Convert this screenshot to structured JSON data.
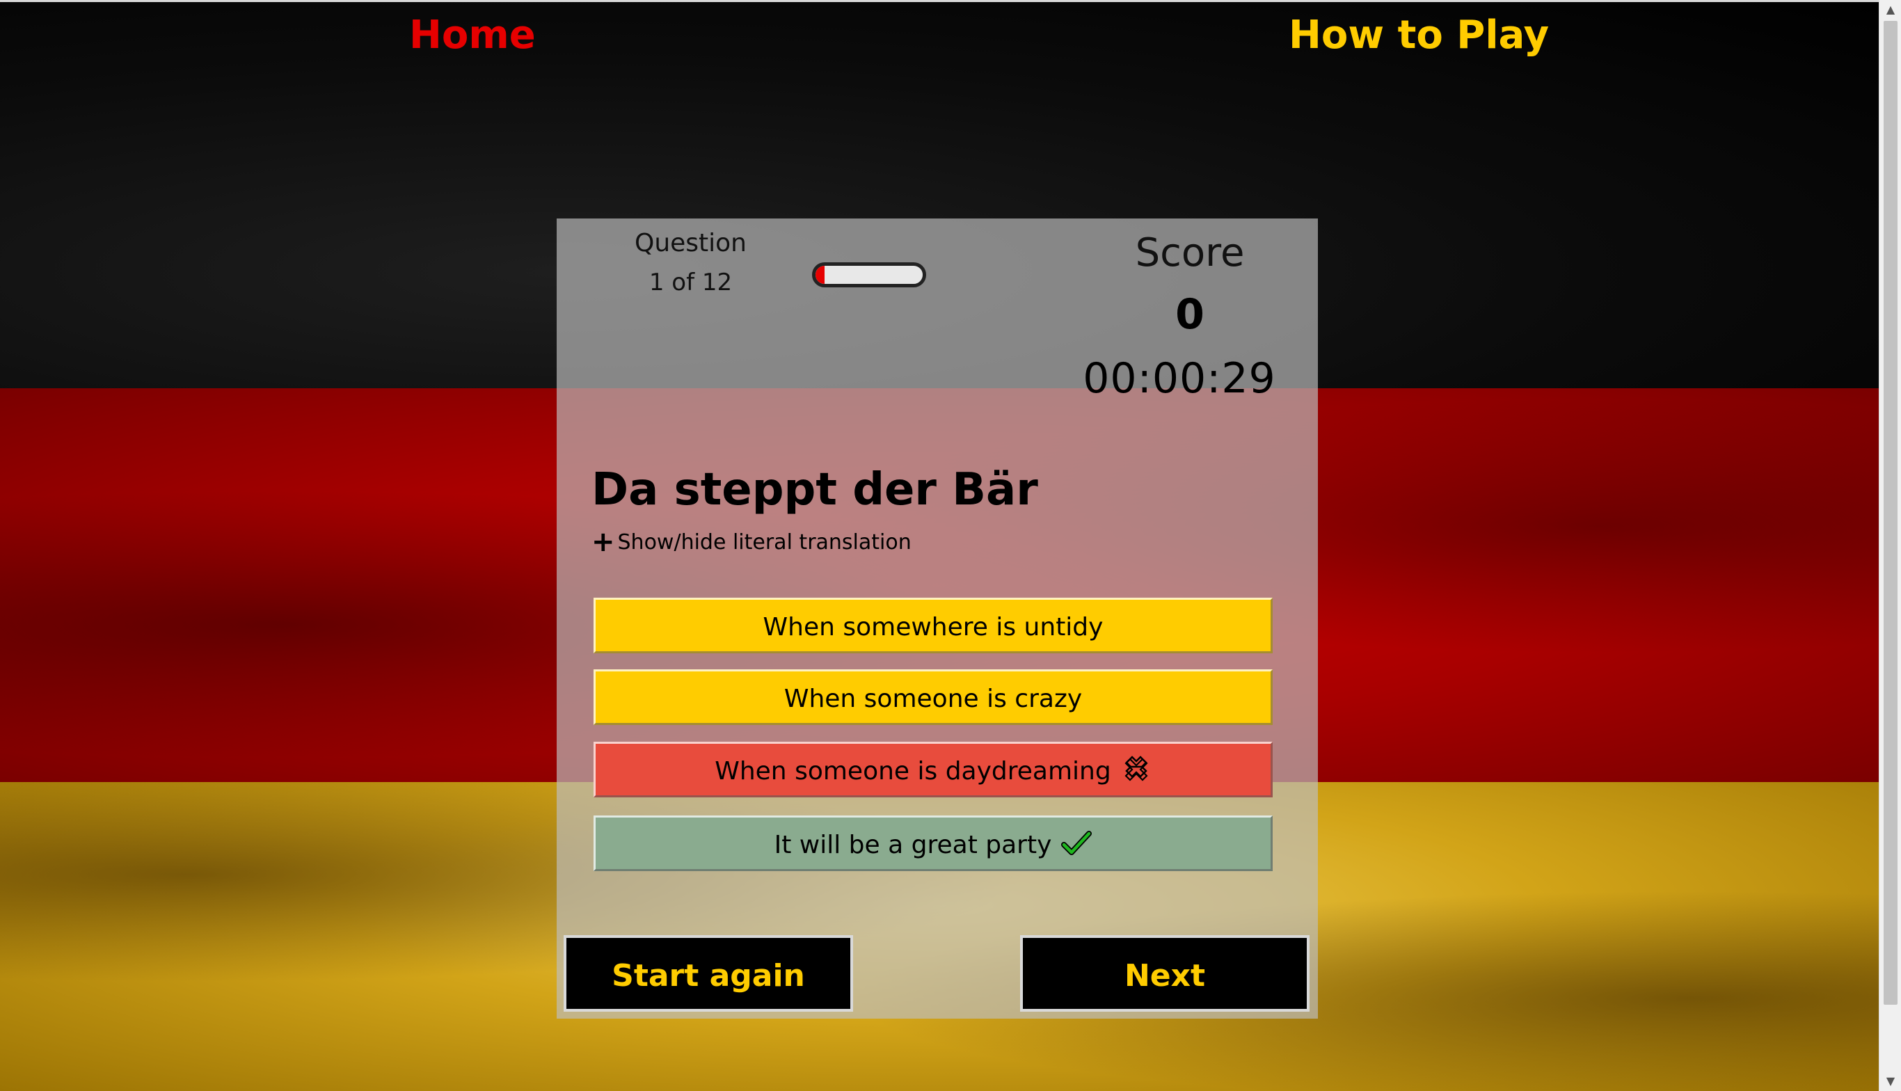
{
  "nav": {
    "home_label": "Home",
    "how_to_play_label": "How to Play"
  },
  "quiz": {
    "question_label": "Question",
    "question_count": "1 of 12",
    "progress_fraction": 0.083,
    "score_label": "Score",
    "score_value": "0",
    "timer": "00:00:29",
    "phrase": "Da steppt der Bär",
    "toggle_translation_label": "Show/hide literal translation",
    "answers": [
      {
        "text": "When somewhere is untidy",
        "state": "neutral",
        "color": "#ffcc00"
      },
      {
        "text": "When someone is crazy",
        "state": "neutral",
        "color": "#ffcc00"
      },
      {
        "text": "When someone is daydreaming",
        "state": "wrong",
        "icon": "cross-icon",
        "color": "#e84c3d"
      },
      {
        "text": "It will be a great party",
        "state": "correct",
        "icon": "check-icon",
        "color": "#8aab8f"
      }
    ],
    "start_again_label": "Start again",
    "next_label": "Next"
  },
  "colors": {
    "home_link": "#e60000",
    "how_to_play_link": "#ffcc00",
    "button_text": "#ffcc00",
    "flag_black": "#000000",
    "flag_red": "#c90000",
    "flag_gold": "#e5b42a"
  }
}
